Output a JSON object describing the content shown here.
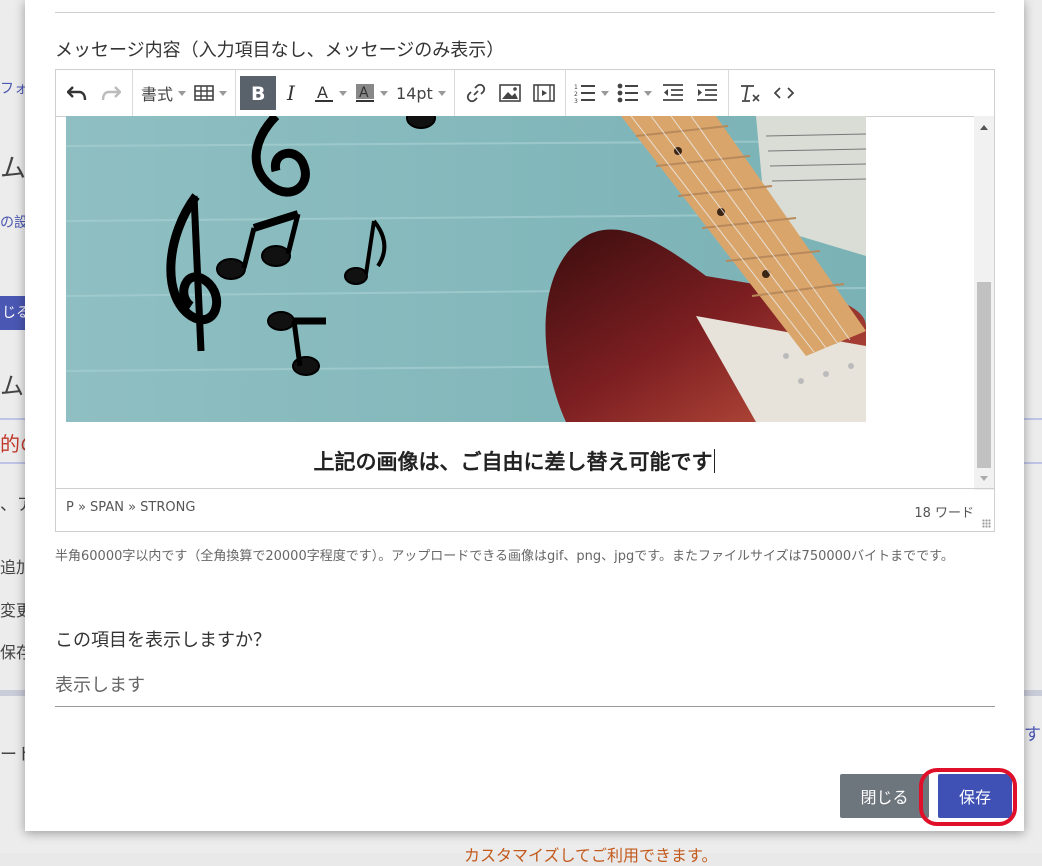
{
  "background": {
    "fragments": [
      "フォ",
      "ム名",
      "の設",
      "じる",
      "ムの",
      "的の",
      "、ア",
      "追加",
      "変更",
      "保存",
      "ート",
      "する"
    ],
    "bottom_text": "カスタマイズしてご利用できます。"
  },
  "modal": {
    "message_label": "メッセージ内容（入力項目なし、メッセージのみ表示）",
    "toolbar": {
      "format_label": "書式",
      "fontsize_label": "14pt"
    },
    "editor": {
      "caption": "上記の画像は、ご自由に差し替え可能です",
      "path": "P » SPAN » STRONG",
      "word_count": "18 ワード"
    },
    "hint": "半角60000字以内です（全角換算で20000字程度です）。アップロードできる画像はgif、png、jpgです。またファイルサイズは750000バイトまでです。",
    "display_question": "この項目を表示しますか？",
    "display_value": "表示します",
    "close_button": "閉じる",
    "save_button": "保存"
  },
  "colors": {
    "primary": "#3f51b5",
    "secondary": "#6d757d",
    "highlight": "#e0102a"
  }
}
